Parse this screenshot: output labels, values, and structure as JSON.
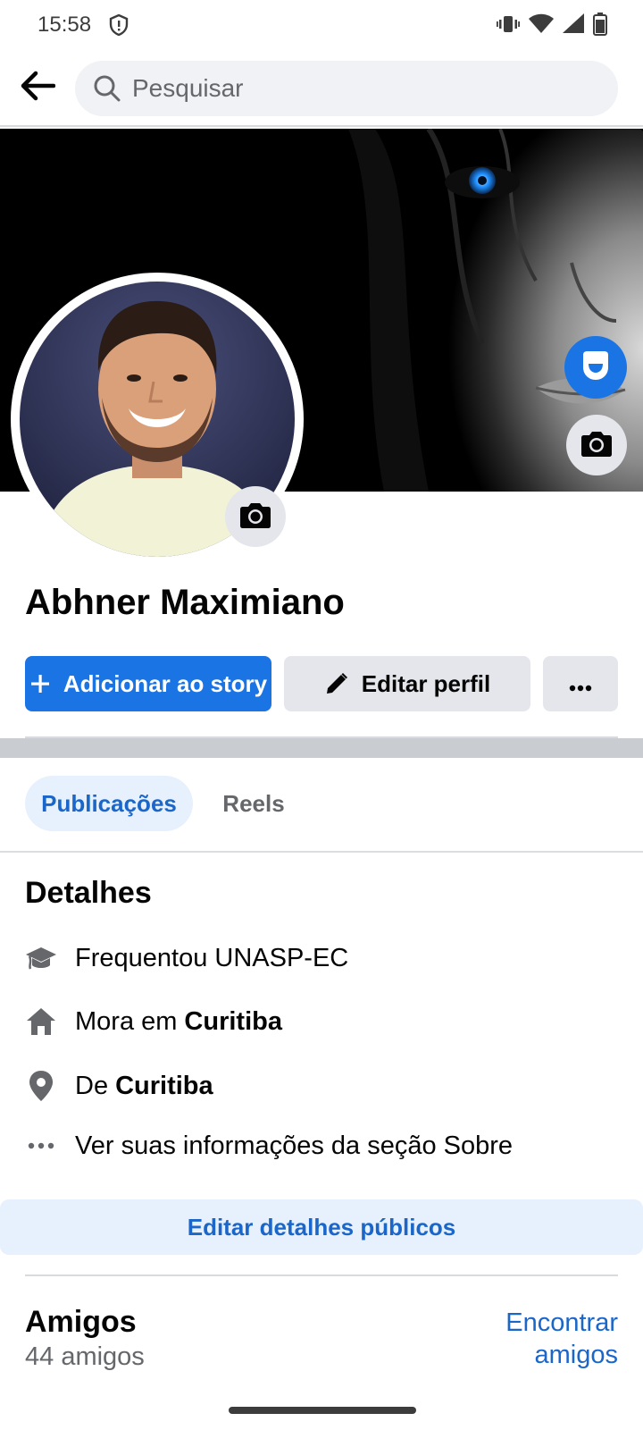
{
  "status_bar": {
    "time": "15:58",
    "icons": [
      "shield-icon",
      "vibrate-icon",
      "wifi-icon",
      "signal-icon",
      "battery-icon"
    ]
  },
  "header": {
    "back_icon": "arrow-left-icon",
    "search_placeholder": "Pesquisar"
  },
  "profile": {
    "name": "Abhner Maximiano"
  },
  "actions": {
    "add_story": "Adicionar ao story",
    "edit_profile": "Editar perfil",
    "more": "···"
  },
  "tabs": [
    {
      "label": "Publicações",
      "active": true
    },
    {
      "label": "Reels",
      "active": false
    }
  ],
  "details": {
    "title": "Detalhes",
    "items": [
      {
        "icon": "graduation-cap-icon",
        "text": "Frequentou UNASP-EC",
        "bold": ""
      },
      {
        "icon": "home-icon",
        "text": "Mora em",
        "bold": "Curitiba"
      },
      {
        "icon": "location-pin-icon",
        "text": "De",
        "bold": "Curitiba"
      },
      {
        "icon": "more-dots-icon",
        "text": "Ver suas informações da seção Sobre",
        "bold": ""
      }
    ],
    "edit_button": "Editar detalhes públicos"
  },
  "friends": {
    "title": "Amigos",
    "count": "44 amigos",
    "find_line1": "Encontrar",
    "find_line2": "amigos"
  },
  "colors": {
    "accent": "#1b74e4",
    "accent_text": "#1b66c9",
    "accent_light": "#e7f0fd",
    "secondary_button": "#e4e6eb",
    "muted_text": "#65676b"
  }
}
